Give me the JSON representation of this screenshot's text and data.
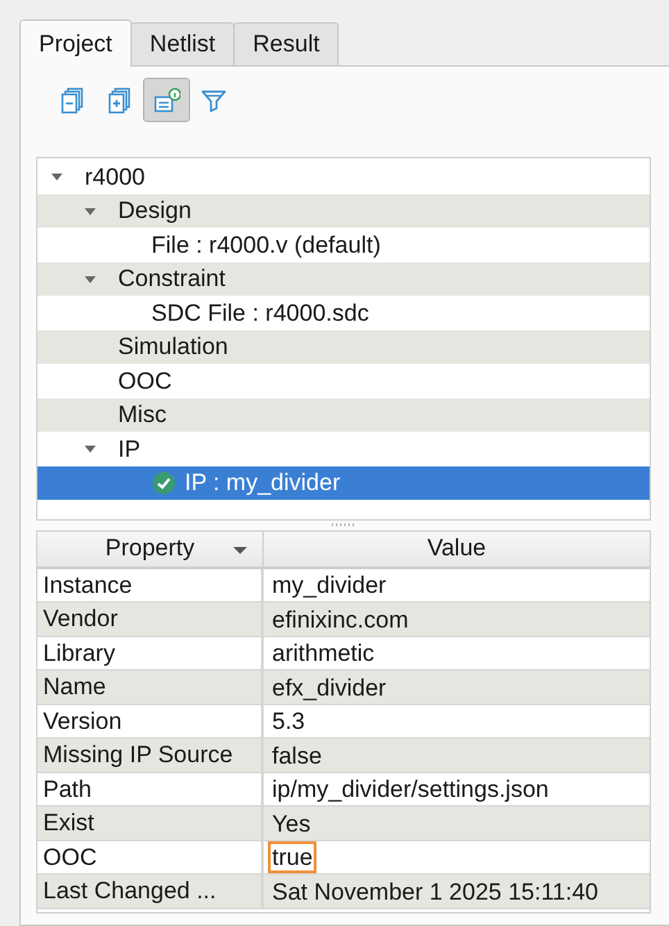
{
  "tabs": [
    {
      "label": "Project",
      "selected": true
    },
    {
      "label": "Netlist",
      "selected": false
    },
    {
      "label": "Result",
      "selected": false
    }
  ],
  "toolbar": [
    {
      "kind": "collapse",
      "pressed": false
    },
    {
      "kind": "expand",
      "pressed": false
    },
    {
      "kind": "details",
      "pressed": true
    },
    {
      "kind": "filter",
      "pressed": false
    }
  ],
  "tree": [
    {
      "label": "r4000",
      "expanded": true,
      "selected": false,
      "children": [
        {
          "label": "Design",
          "expanded": true,
          "selected": false,
          "children": [
            {
              "label": "File : r4000.v (default)",
              "selected": false
            }
          ]
        },
        {
          "label": "Constraint",
          "expanded": true,
          "selected": false,
          "children": [
            {
              "label": "SDC File : r4000.sdc",
              "selected": false
            }
          ]
        },
        {
          "label": "Simulation",
          "selected": false
        },
        {
          "label": "OOC",
          "selected": false
        },
        {
          "label": "Misc",
          "selected": false
        },
        {
          "label": "IP",
          "expanded": true,
          "selected": false,
          "children": [
            {
              "label": "IP : my_divider",
              "selected": true,
              "valid": true
            }
          ]
        }
      ]
    }
  ],
  "table": {
    "columns": [
      {
        "label": "Property",
        "sort_indicator": true
      },
      {
        "label": "Value",
        "sort_indicator": false
      }
    ],
    "rows": [
      {
        "property": "Instance",
        "value": "my_divider",
        "focused": false
      },
      {
        "property": "Vendor",
        "value": "efinixinc.com",
        "focused": false
      },
      {
        "property": "Library",
        "value": "arithmetic",
        "focused": false
      },
      {
        "property": "Name",
        "value": "efx_divider",
        "focused": false
      },
      {
        "property": "Version",
        "value": "5.3",
        "focused": false
      },
      {
        "property": "Missing IP Source",
        "value": "false",
        "focused": false
      },
      {
        "property": "Path",
        "value": "ip/my_divider/settings.json",
        "focused": false
      },
      {
        "property": "Exist",
        "value": "Yes",
        "focused": false
      },
      {
        "property": "OOC",
        "value": "true",
        "focused": true
      },
      {
        "property": "Last Changed ...",
        "value": "Sat November 1 2025 15:11:40",
        "focused": false
      }
    ]
  }
}
